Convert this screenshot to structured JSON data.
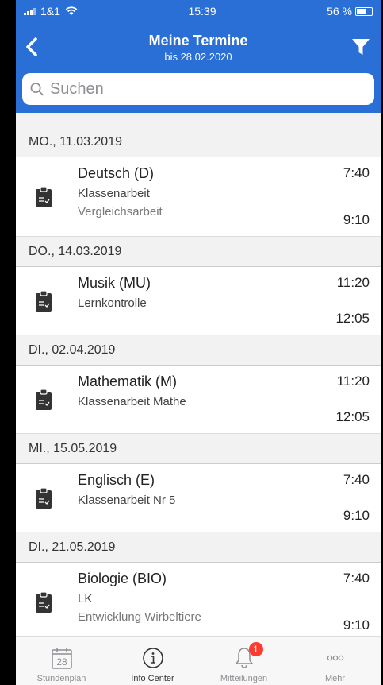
{
  "status_bar": {
    "carrier": "1&1",
    "time": "15:39",
    "battery": "56 %"
  },
  "nav": {
    "title": "Meine Termine",
    "subtitle": "bis 28.02.2020"
  },
  "search": {
    "placeholder": "Suchen"
  },
  "sections": [
    {
      "date": "MO., 11.03.2019",
      "items": [
        {
          "subject": "Deutsch (D)",
          "type": "Klassenarbeit",
          "description": "Vergleichsarbeit",
          "start": "7:40",
          "end": "9:10"
        }
      ]
    },
    {
      "date": "DO., 14.03.2019",
      "items": [
        {
          "subject": "Musik (MU)",
          "type": "Lernkontrolle",
          "description": "",
          "start": "11:20",
          "end": "12:05"
        }
      ]
    },
    {
      "date": "DI., 02.04.2019",
      "items": [
        {
          "subject": "Mathematik (M)",
          "type": "Klassenarbeit Mathe",
          "description": "",
          "start": "11:20",
          "end": "12:05"
        }
      ]
    },
    {
      "date": "MI., 15.05.2019",
      "items": [
        {
          "subject": "Englisch (E)",
          "type": "Klassenarbeit Nr 5",
          "description": "",
          "start": "7:40",
          "end": "9:10"
        }
      ]
    },
    {
      "date": "DI., 21.05.2019",
      "items": [
        {
          "subject": "Biologie (BIO)",
          "type": "LK",
          "description": "Entwicklung Wirbeltiere",
          "start": "7:40",
          "end": "9:10"
        }
      ]
    }
  ],
  "tabs": [
    {
      "label": "Stundenplan",
      "icon": "calendar-icon",
      "icon_text": "28"
    },
    {
      "label": "Info Center",
      "icon": "info-icon"
    },
    {
      "label": "Mitteilungen",
      "icon": "bell-icon",
      "badge": "1"
    },
    {
      "label": "Mehr",
      "icon": "more-icon"
    }
  ],
  "colors": {
    "accent": "#2a6fd6",
    "badge": "#ff3b30"
  }
}
